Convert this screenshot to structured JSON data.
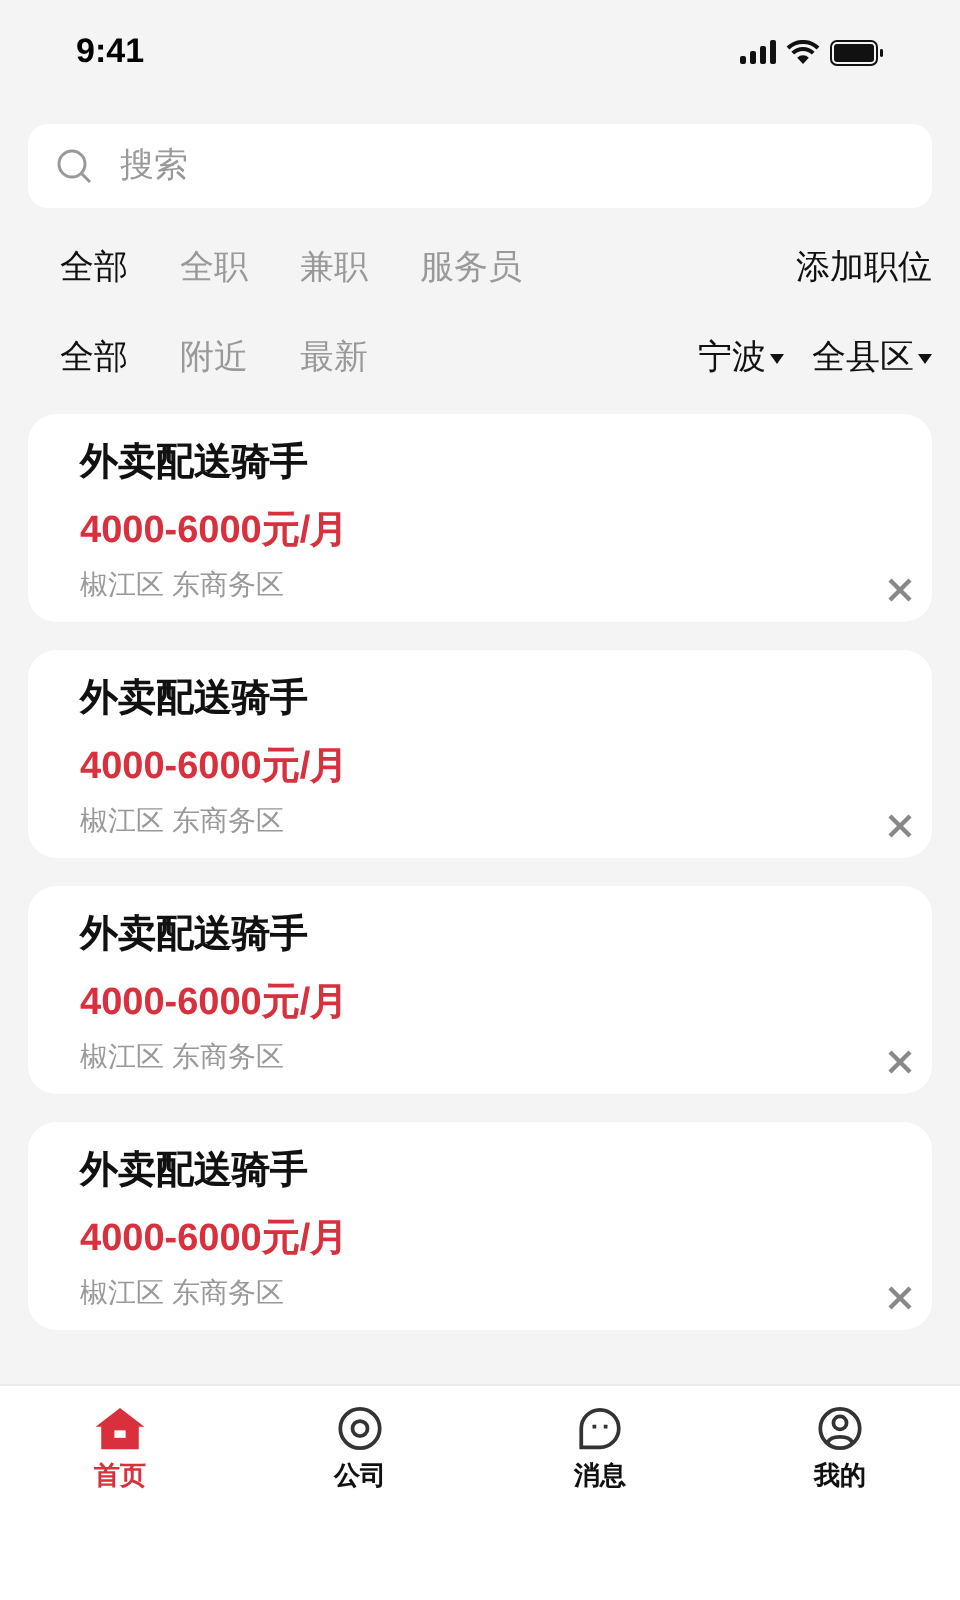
{
  "status_bar": {
    "time": "9:41"
  },
  "search": {
    "placeholder": "搜索"
  },
  "category_tabs": [
    {
      "label": "全部",
      "selected": true
    },
    {
      "label": "全职",
      "selected": false
    },
    {
      "label": "兼职",
      "selected": false
    },
    {
      "label": "服务员",
      "selected": false
    }
  ],
  "add_position": "添加职位",
  "sort_tabs": [
    {
      "label": "全部",
      "selected": true
    },
    {
      "label": "附近",
      "selected": false
    },
    {
      "label": "最新",
      "selected": false
    }
  ],
  "dropdowns": [
    "宁波",
    "全县区"
  ],
  "jobs": [
    {
      "title": "外卖配送骑手",
      "salary": "4000-6000元/月",
      "location": "椒江区 东商务区"
    },
    {
      "title": "外卖配送骑手",
      "salary": "4000-6000元/月",
      "location": "椒江区 东商务区"
    },
    {
      "title": "外卖配送骑手",
      "salary": "4000-6000元/月",
      "location": "椒江区 东商务区"
    },
    {
      "title": "外卖配送骑手",
      "salary": "4000-6000元/月",
      "location": "椒江区 东商务区"
    }
  ],
  "bottom_nav": [
    {
      "label": "首页",
      "kind": "home",
      "selected": true
    },
    {
      "label": "公司",
      "kind": "company",
      "selected": false
    },
    {
      "label": "消息",
      "kind": "messages",
      "selected": false
    },
    {
      "label": "我的",
      "kind": "profile",
      "selected": false
    }
  ]
}
